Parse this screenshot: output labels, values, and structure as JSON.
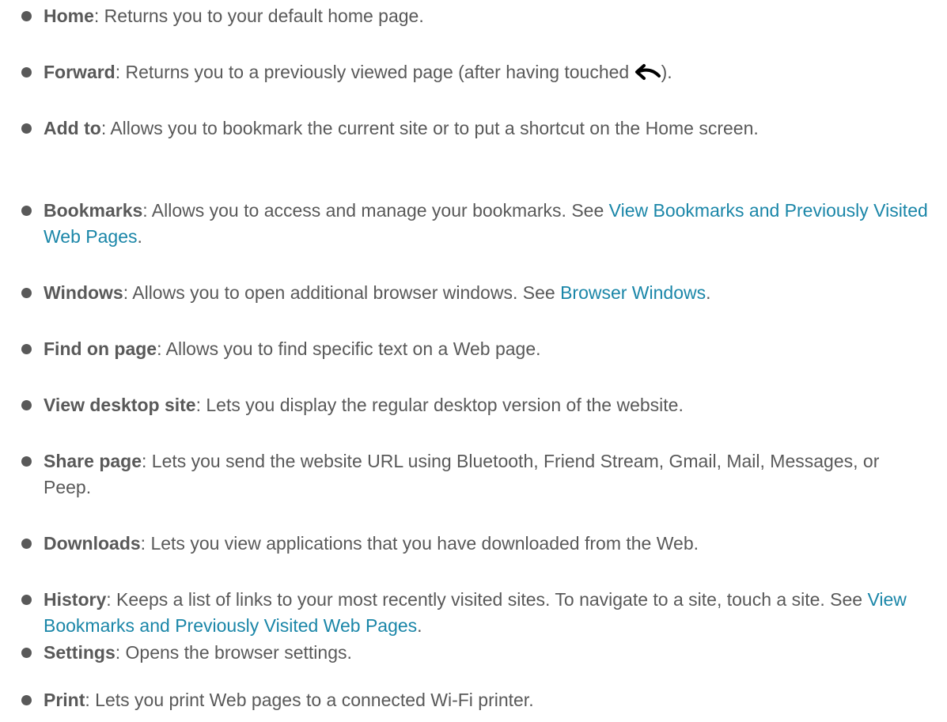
{
  "colors": {
    "text": "#595959",
    "link": "#1a86a8",
    "bullet": "#595959",
    "icon": "#000000"
  },
  "items": [
    {
      "term": "Home",
      "description": ": Returns you to your default home page."
    },
    {
      "term": "Forward",
      "description": ": Returns you to a previously viewed page (after having touched ",
      "icon": "back-arrow-icon",
      "after_icon": ")."
    },
    {
      "term": "Add to",
      "description": ": Allows you to bookmark the current site or to put a shortcut on the Home screen."
    },
    {
      "term": "Bookmarks",
      "description": ": Allows you to access and manage your bookmarks. See ",
      "link": "View Bookmarks and Previously Visited Web Pages",
      "after_link": "."
    },
    {
      "term": "Windows",
      "description": ": Allows you to open additional browser windows. See ",
      "link": "Browser Windows",
      "after_link": "."
    },
    {
      "term": "Find on page",
      "description": ": Allows you to find specific text on a Web page."
    },
    {
      "term": "View desktop site",
      "description": ": Lets you display the regular desktop version of the website."
    },
    {
      "term": "Share page",
      "description": ": Lets you send the website URL using Bluetooth, Friend Stream, Gmail, Mail, Messages, or Peep."
    },
    {
      "term": "Downloads",
      "description": ": Lets you view applications that you have downloaded from the Web."
    },
    {
      "term": "History",
      "description": ": Keeps a list of links to your most recently visited sites. To navigate to a site, touch a site. See ",
      "link": "View Bookmarks and Previously Visited Web Pages",
      "after_link": "."
    },
    {
      "term": "Settings",
      "description": ": Opens the browser settings."
    },
    {
      "term": "Print",
      "description": ": Lets you print Web pages to a connected Wi-Fi printer."
    }
  ]
}
